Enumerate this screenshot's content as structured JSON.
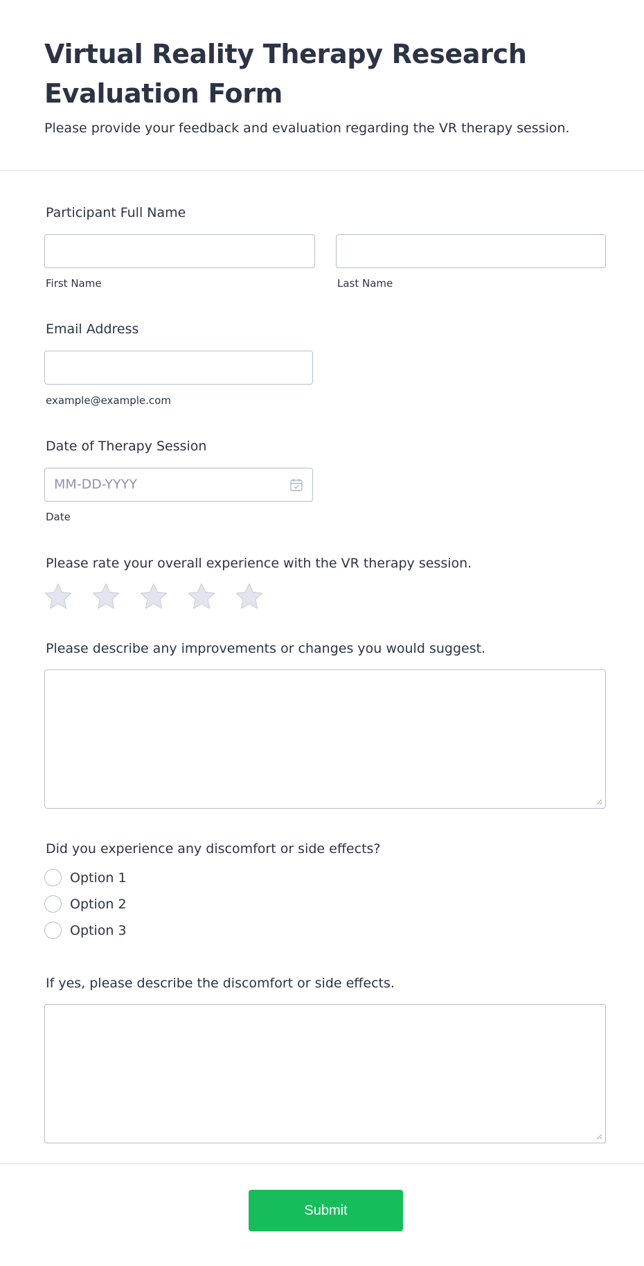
{
  "form": {
    "title": "Virtual Reality Therapy Research Evaluation Form",
    "description": "Please provide your feedback and evaluation regarding the VR therapy session."
  },
  "name_field": {
    "label": "Participant Full Name",
    "first_value": "",
    "last_value": "",
    "first_sublabel": "First Name",
    "last_sublabel": "Last Name"
  },
  "email_field": {
    "label": "Email Address",
    "value": "",
    "sublabel": "example@example.com"
  },
  "date_field": {
    "label": "Date of Therapy Session",
    "placeholder": "MM-DD-YYYY",
    "sublabel": "Date",
    "icon": "calendar-icon"
  },
  "rating_field": {
    "label": "Please rate your overall experience with the VR therapy session.",
    "max_stars": 5,
    "value": 0,
    "icon": "star-icon",
    "empty_color": "#e2e5ee"
  },
  "improvements_field": {
    "label": "Please describe any improvements or changes you would suggest.",
    "value": ""
  },
  "discomfort_field": {
    "label": "Did you experience any discomfort or side effects?",
    "options": [
      "Option 1",
      "Option 2",
      "Option 3"
    ]
  },
  "discomfort_details_field": {
    "label": "If yes, please describe the discomfort or side effects.",
    "value": ""
  },
  "submit": {
    "label": "Submit",
    "color": "#18bd5b"
  }
}
